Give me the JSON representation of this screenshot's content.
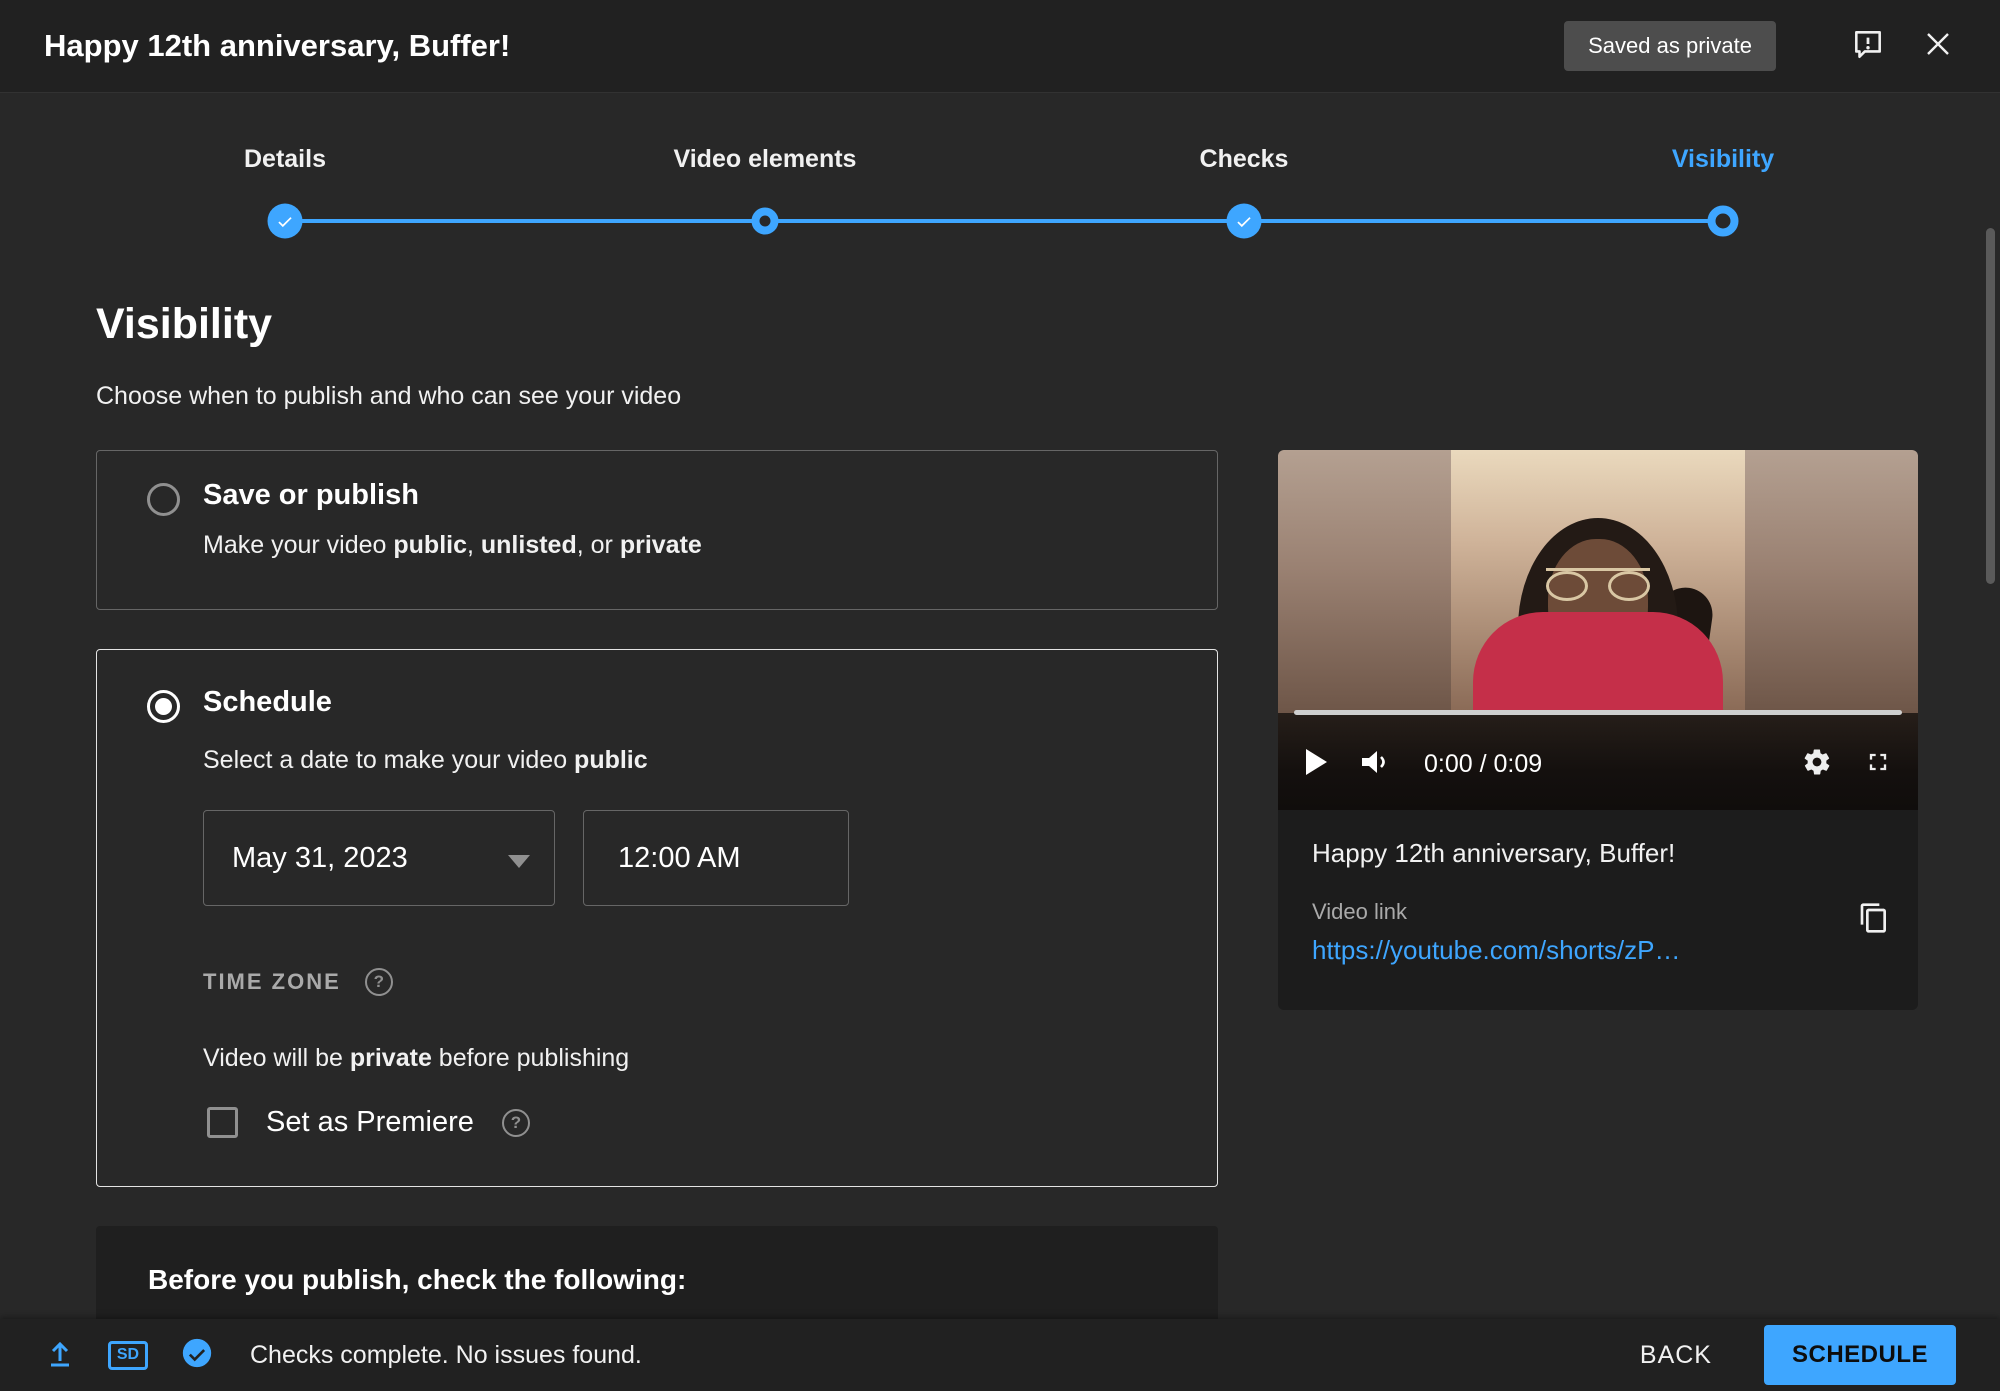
{
  "colors": {
    "accent": "#3ea6ff",
    "link": "#3ea6ff",
    "badge_bg": "#4d4d4d"
  },
  "header": {
    "title": "Happy 12th anniversary, Buffer!",
    "saved_badge": "Saved as private"
  },
  "stepper": {
    "steps": [
      {
        "label": "Details",
        "state": "complete"
      },
      {
        "label": "Video elements",
        "state": "visited"
      },
      {
        "label": "Checks",
        "state": "complete"
      },
      {
        "label": "Visibility",
        "state": "current"
      }
    ]
  },
  "main": {
    "heading": "Visibility",
    "subheading": "Choose when to publish and who can see your video",
    "save_or_publish": {
      "label": "Save or publish",
      "desc": [
        "Make your video ",
        "public",
        ", ",
        "unlisted",
        ", or ",
        "private"
      ],
      "selected": false
    },
    "schedule": {
      "label": "Schedule",
      "desc": [
        "Select a date to make your video ",
        "public"
      ],
      "selected": true,
      "date_value": "May 31, 2023",
      "time_value": "12:00 AM",
      "timezone_label": "TIME ZONE",
      "private_note": [
        "Video will be ",
        "private",
        " before publishing"
      ],
      "premiere_label": "Set as Premiere",
      "premiere_checked": false
    },
    "checks_heading": "Before you publish, check the following:"
  },
  "preview": {
    "time": "0:00 / 0:09",
    "title": "Happy 12th anniversary, Buffer!",
    "link_label": "Video link",
    "link": "https://youtube.com/shorts/zP…"
  },
  "footer": {
    "sd_badge": "SD",
    "status": "Checks complete. No issues found.",
    "back": "BACK",
    "schedule": "SCHEDULE"
  }
}
